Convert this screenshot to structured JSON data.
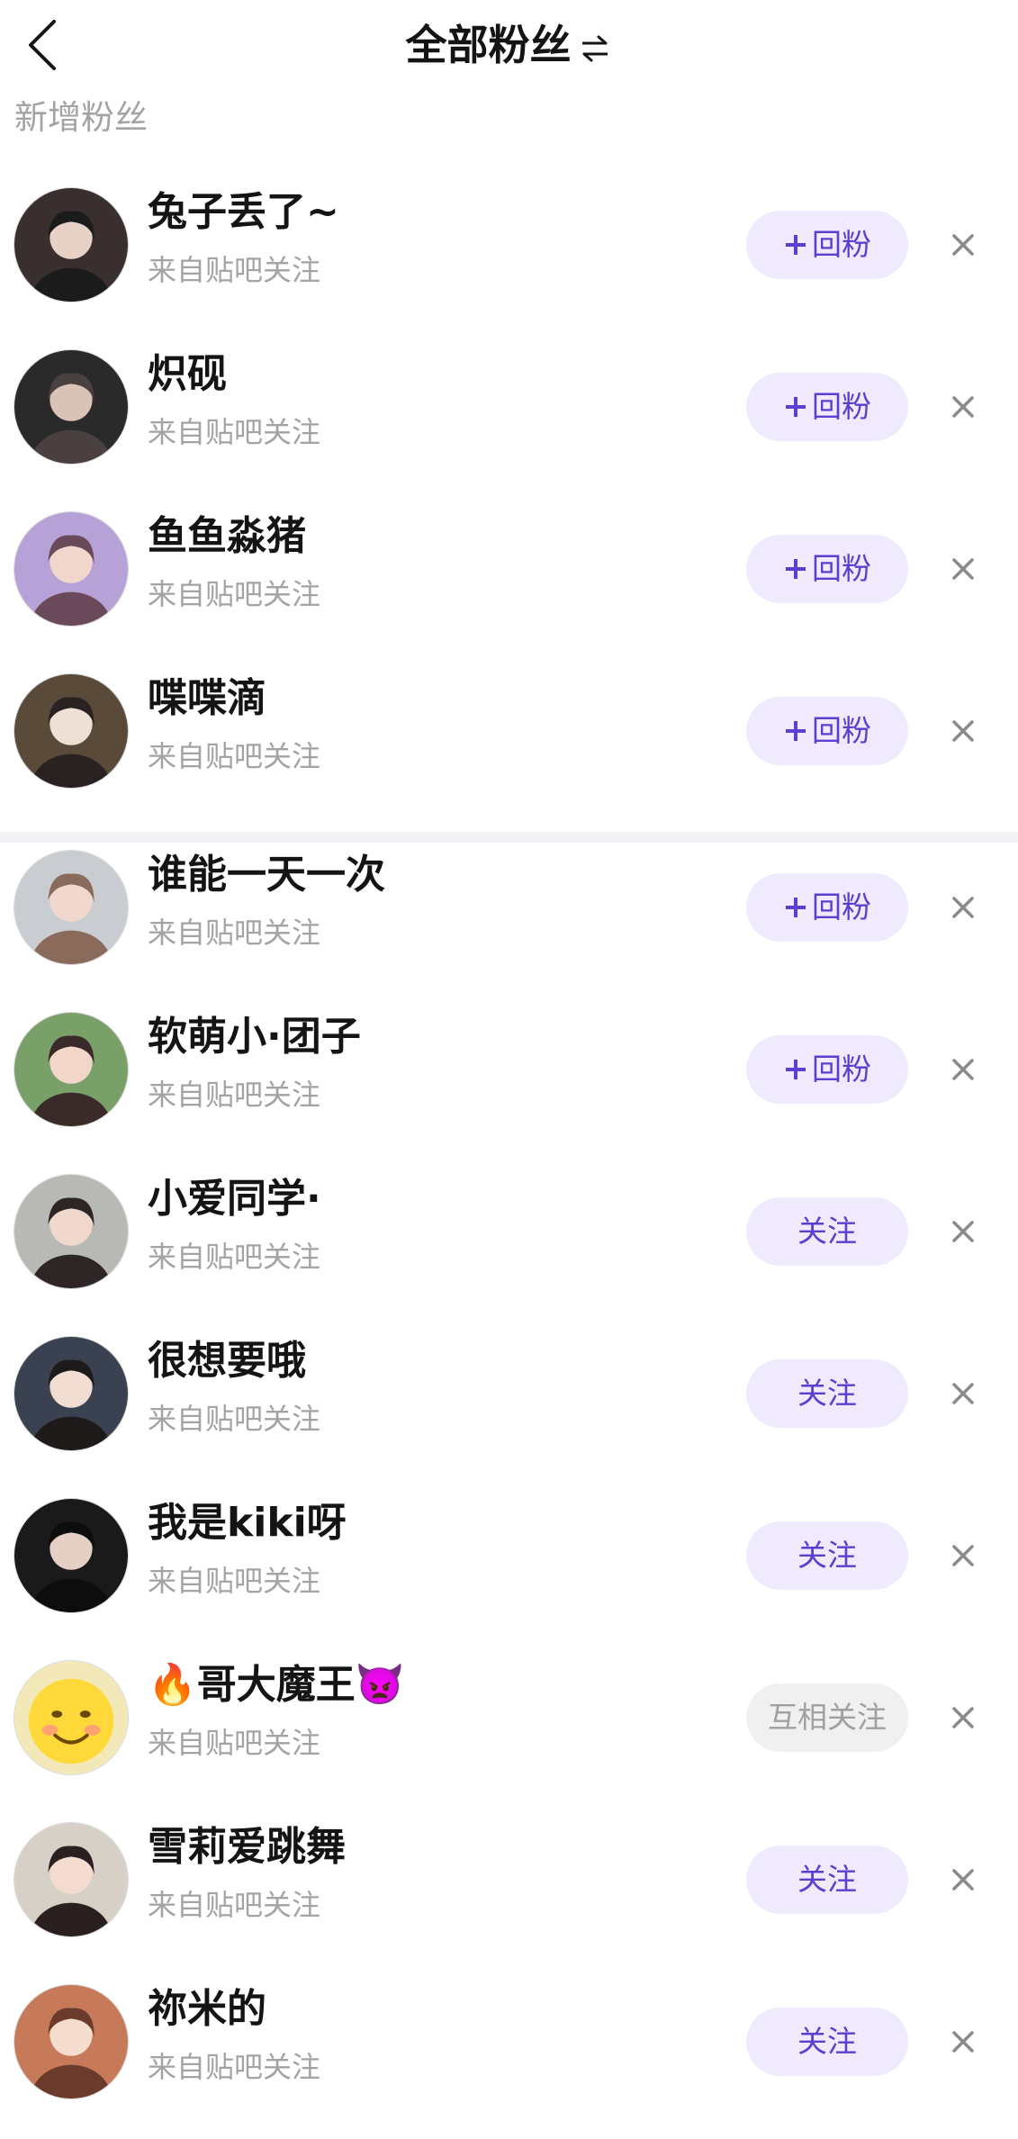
{
  "header": {
    "title": "全部粉丝",
    "back_icon": "chevron-left-icon",
    "switch_icon": "swap-arrows-icon"
  },
  "section_label": "新增粉丝",
  "colors": {
    "accent": "#5b3fd0",
    "button_bg": "#efeafd",
    "muted_bg": "#f0f0f0",
    "muted_text": "#a0a0a0",
    "secondary_text": "#a3a3a3"
  },
  "fans": [
    {
      "name": "兔子丢了~",
      "source": "来自贴吧关注",
      "action": "回粉",
      "has_plus": true
    },
    {
      "name": "炽砚",
      "source": "来自贴吧关注",
      "action": "回粉",
      "has_plus": true
    },
    {
      "name": "鱼鱼淼猪",
      "source": "来自贴吧关注",
      "action": "回粉",
      "has_plus": true
    },
    {
      "name": "喋喋滴",
      "source": "来自贴吧关注",
      "action": "回粉",
      "has_plus": true
    },
    {
      "name": "谁能一天一次",
      "source": "来自贴吧关注",
      "action": "回粉",
      "has_plus": true
    },
    {
      "name": "软萌小·团子",
      "source": "来自贴吧关注",
      "action": "回粉",
      "has_plus": true
    },
    {
      "name": "小爱同学·",
      "source": "来自贴吧关注",
      "action": "关注",
      "has_plus": false
    },
    {
      "name": "很想要哦",
      "source": "来自贴吧关注",
      "action": "关注",
      "has_plus": false
    },
    {
      "name": "我是kiki呀",
      "source": "来自贴吧关注",
      "action": "关注",
      "has_plus": false
    },
    {
      "name": "🔥哥大魔王👿",
      "source": "来自贴吧关注",
      "action": "互相关注",
      "has_plus": false,
      "muted": true
    },
    {
      "name": "雪莉爱跳舞",
      "source": "来自贴吧关注",
      "action": "关注",
      "has_plus": false
    },
    {
      "name": "祢米的",
      "source": "来自贴吧关注",
      "action": "关注",
      "has_plus": false
    }
  ]
}
